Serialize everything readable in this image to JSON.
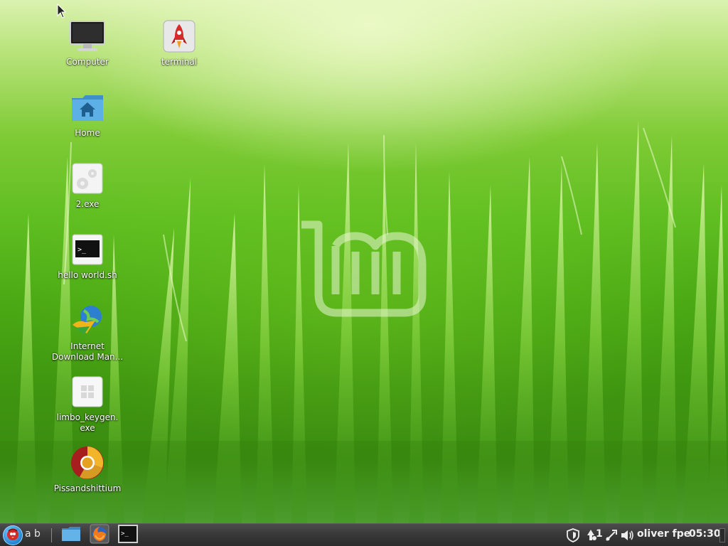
{
  "desktop": {
    "icons": [
      {
        "label": "Computer",
        "icon": "monitor-icon"
      },
      {
        "label": "terminal",
        "icon": "rocket-icon"
      },
      {
        "label": "Home",
        "icon": "home-folder-icon"
      },
      {
        "label": "2.exe",
        "icon": "wine-exe-icon"
      },
      {
        "label": "hello world.sh",
        "icon": "terminal-script-icon"
      },
      {
        "label": "Internet\nDownload Man...",
        "icon": "download-globe-icon"
      },
      {
        "label": "limbo_keygen.\nexe",
        "icon": "windows-exe-icon"
      },
      {
        "label": "Pissandshittium",
        "icon": "chromium-icon"
      }
    ]
  },
  "taskbar": {
    "menu_label": "a b",
    "launchers": [
      {
        "name": "files-launcher",
        "icon": "folder-icon"
      },
      {
        "name": "firefox-launcher",
        "icon": "firefox-icon"
      },
      {
        "name": "terminal-launcher",
        "icon": "terminal-icon"
      }
    ],
    "tray": {
      "update_count": "1",
      "user_and_layout": "oliver fpe",
      "clock": "05:30"
    }
  },
  "colors": {
    "taskbar_bg": "#383838",
    "label_text": "#ffffff",
    "accent_green": "#5fbe21"
  }
}
